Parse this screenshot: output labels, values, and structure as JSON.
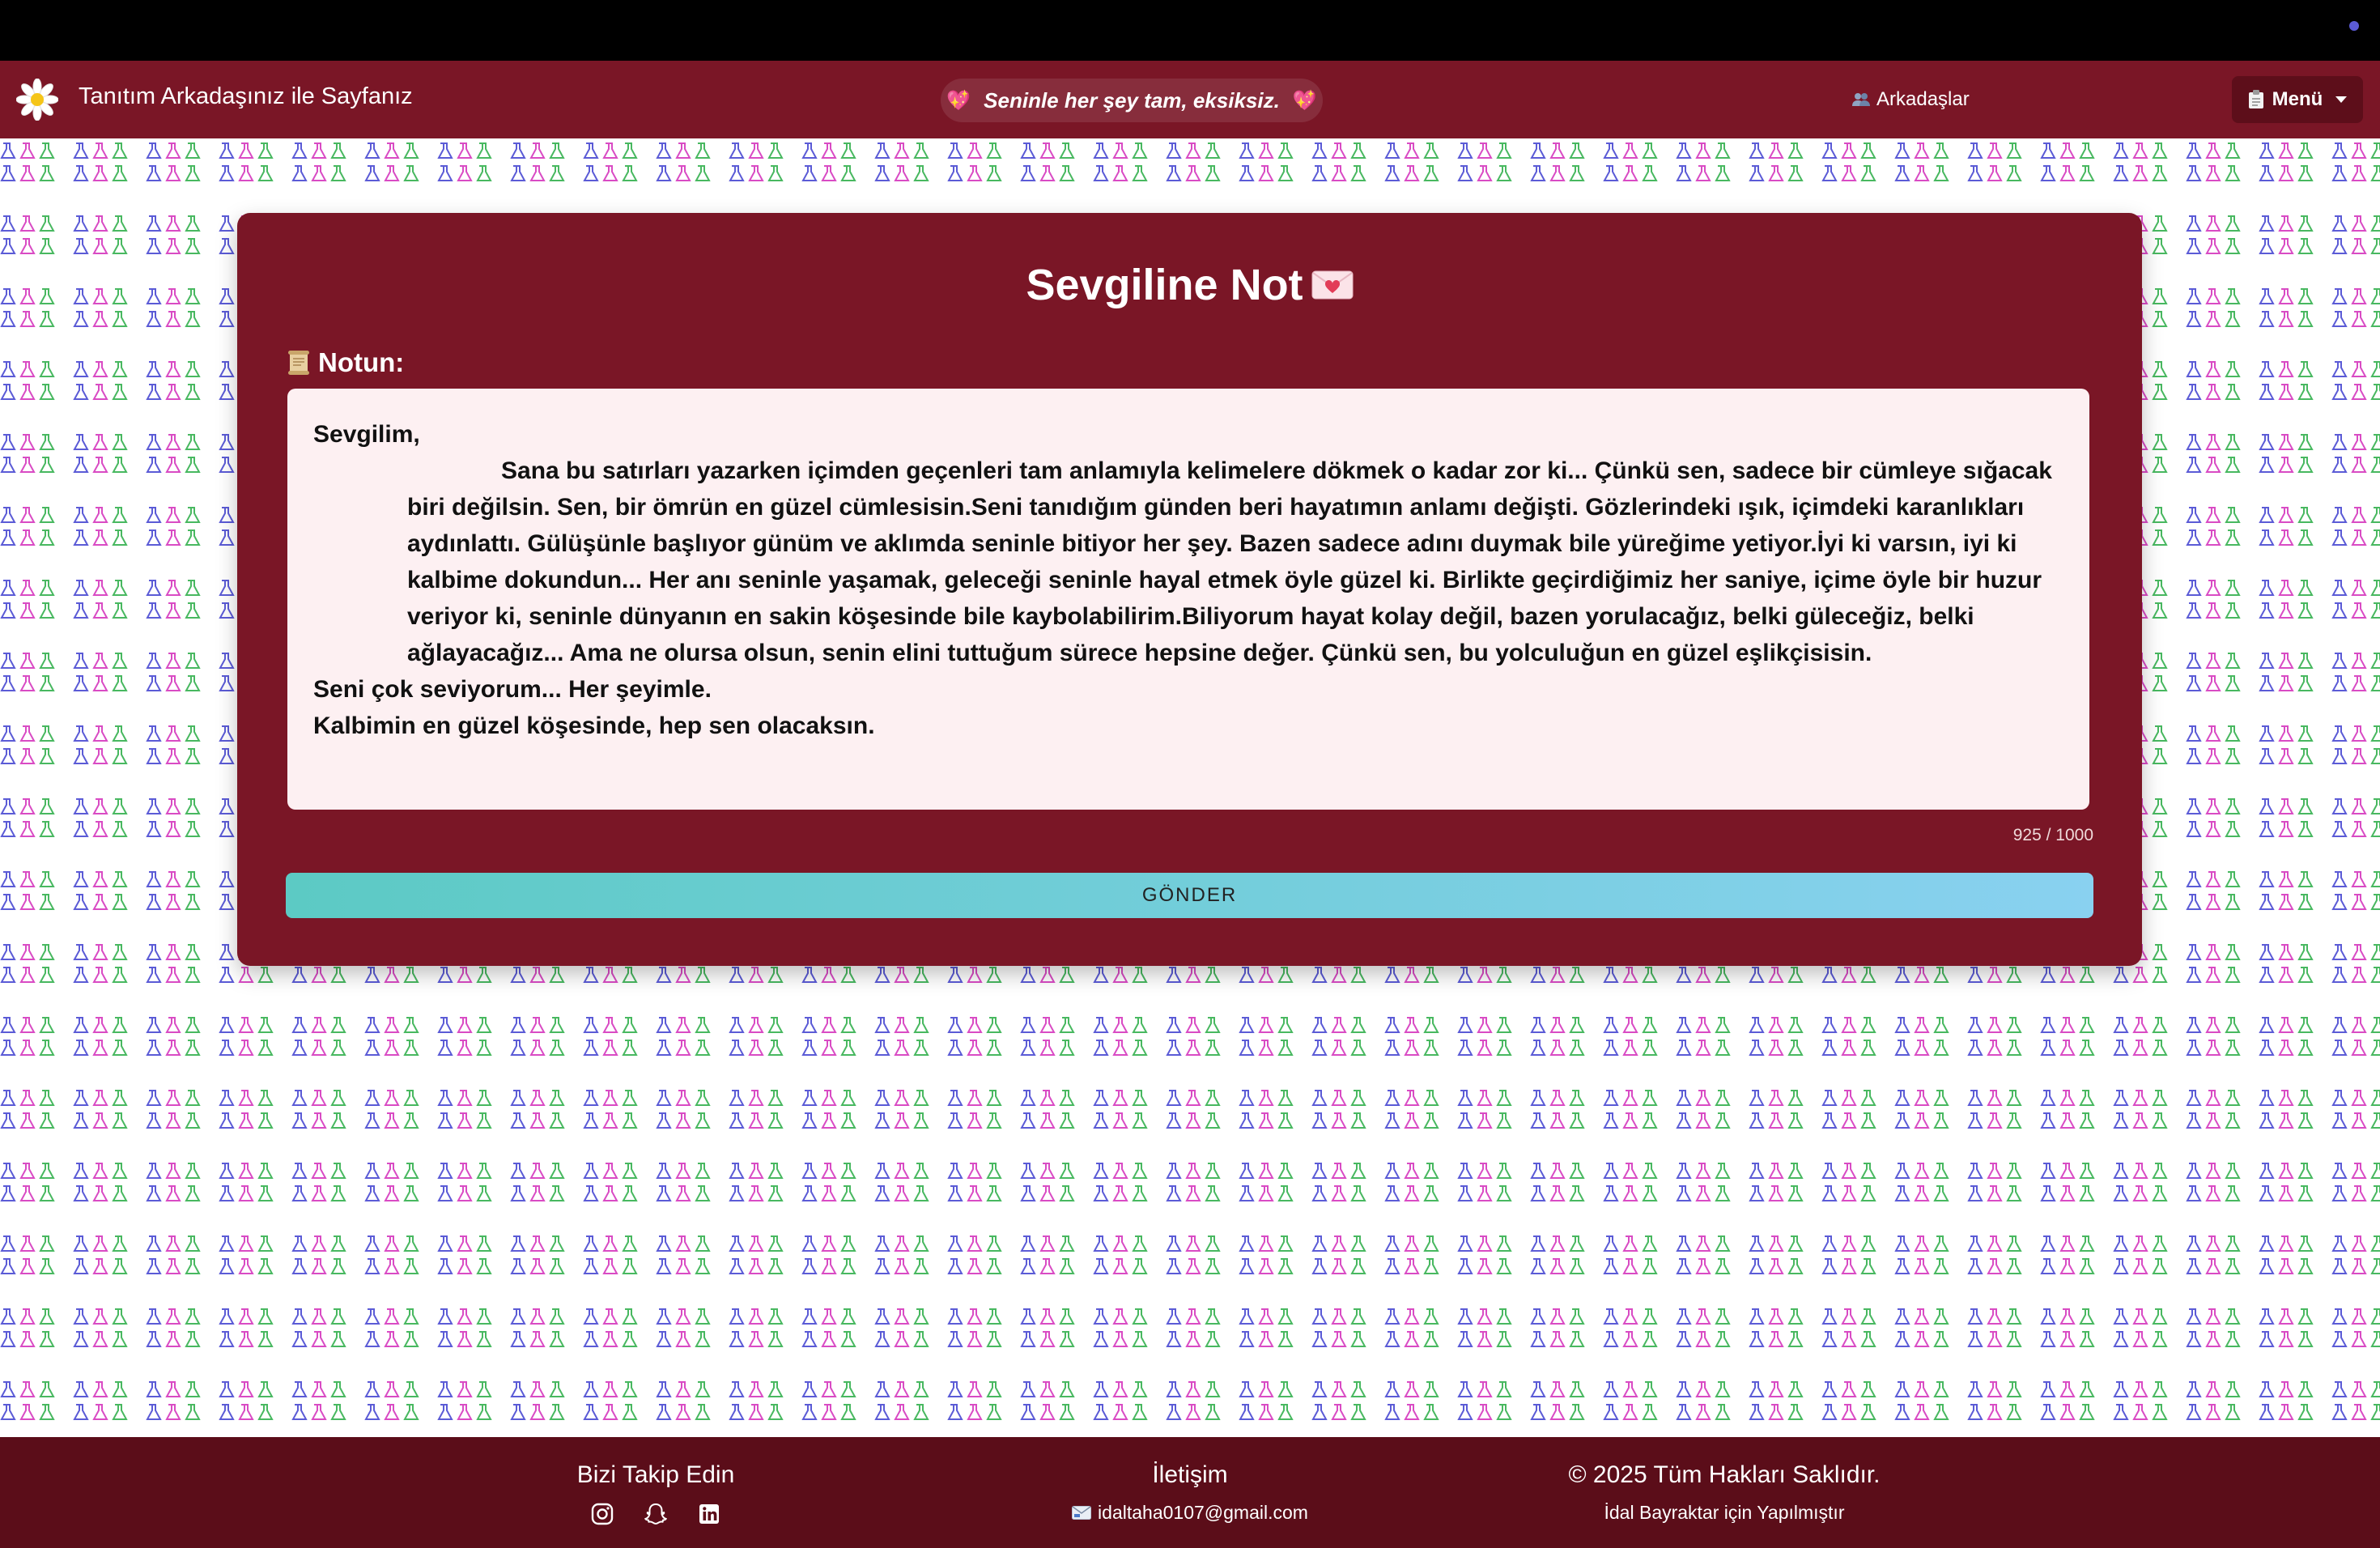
{
  "navbar": {
    "brand_text": "Tanıtım Arkadaşınız ile Sayfanız",
    "tagline": "Seninle her şey tam, eksiksiz.",
    "friends_label": "Arkadaşlar",
    "menu_label": "Menü"
  },
  "card": {
    "title": "Sevgiline Not",
    "note_label": "Notun:",
    "note": {
      "greeting": "Sevgilim,",
      "body": "Sana bu satırları yazarken içimden geçenleri tam anlamıyla kelimelere dökmek o kadar zor ki... Çünkü sen, sadece bir cümleye sığacak biri değilsin. Sen, bir ömrün en güzel cümlesisin.Seni tanıdığım günden beri hayatımın anlamı değişti. Gözlerindeki ışık, içimdeki karanlıkları aydınlattı. Gülüşünle başlıyor günüm ve aklımda seninle bitiyor her şey. Bazen sadece adını duymak bile yüreğime yetiyor.İyi ki varsın, iyi ki kalbime dokundun... Her anı seninle yaşamak, geleceği seninle hayal etmek öyle güzel ki. Birlikte geçirdiğimiz her saniye, içime öyle bir huzur veriyor ki, seninle dünyanın en sakin köşesinde bile kaybolabilirim.Biliyorum hayat kolay değil, bazen yorulacağız, belki güleceğiz, belki ağlayacağız... Ama ne olursa olsun, senin elini tuttuğum sürece hepsine değer. Çünkü sen, bu yolculuğun en güzel eşlikçisisin.",
      "line1": "Seni çok seviyorum... Her şeyimle.",
      "line2": "Kalbimin en güzel köşesinde, hep sen olacaksın."
    },
    "counter": "925 / 1000",
    "send_label": "GÖNDER"
  },
  "footer": {
    "follow_title": "Bizi Takip Edin",
    "contact_title": "İletişim",
    "email": "idaltaha0107@gmail.com",
    "copyright": "© 2025 Tüm Hakları Saklıdır.",
    "made_for": "İdal Bayraktar için Yapılmıştır"
  },
  "icons": {
    "brand": "daisy-icon",
    "heart": "sparkling-heart-icon",
    "friends": "people-icon",
    "menu": "clipboard-icon",
    "title": "love-letter-icon",
    "note_label": "scroll-icon",
    "email": "envelope-icon",
    "social": [
      "instagram-icon",
      "snapchat-icon",
      "linkedin-icon"
    ]
  },
  "colors": {
    "navbar": "#7a1626",
    "card": "#7a1626",
    "footer": "#5b0d19",
    "note_bg": "#fdf0f2",
    "button_start": "#5ccac4",
    "button_end": "#89d1f0"
  }
}
